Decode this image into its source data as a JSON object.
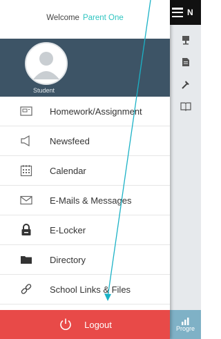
{
  "drawer": {
    "welcome_prefix": "Welcome",
    "welcome_name": "Parent One",
    "role": "Student",
    "menu": [
      {
        "label": "Homework/Assignment",
        "icon": "homework-icon"
      },
      {
        "label": "Newsfeed",
        "icon": "megaphone-icon"
      },
      {
        "label": "Calendar",
        "icon": "calendar-icon"
      },
      {
        "label": "E-Mails & Messages",
        "icon": "envelope-icon"
      },
      {
        "label": "E-Locker",
        "icon": "lock-icon"
      },
      {
        "label": "Directory",
        "icon": "folder-icon"
      },
      {
        "label": "School Links & Files",
        "icon": "link-icon"
      }
    ],
    "logout_label": "Logout"
  },
  "app": {
    "title": "N",
    "bottom_label": "Progre"
  },
  "colors": {
    "header_bg": "#3d5466",
    "accent_teal": "#2ec4c0",
    "logout_red": "#e84a48",
    "annotation_arrow": "#1bb2c6"
  }
}
